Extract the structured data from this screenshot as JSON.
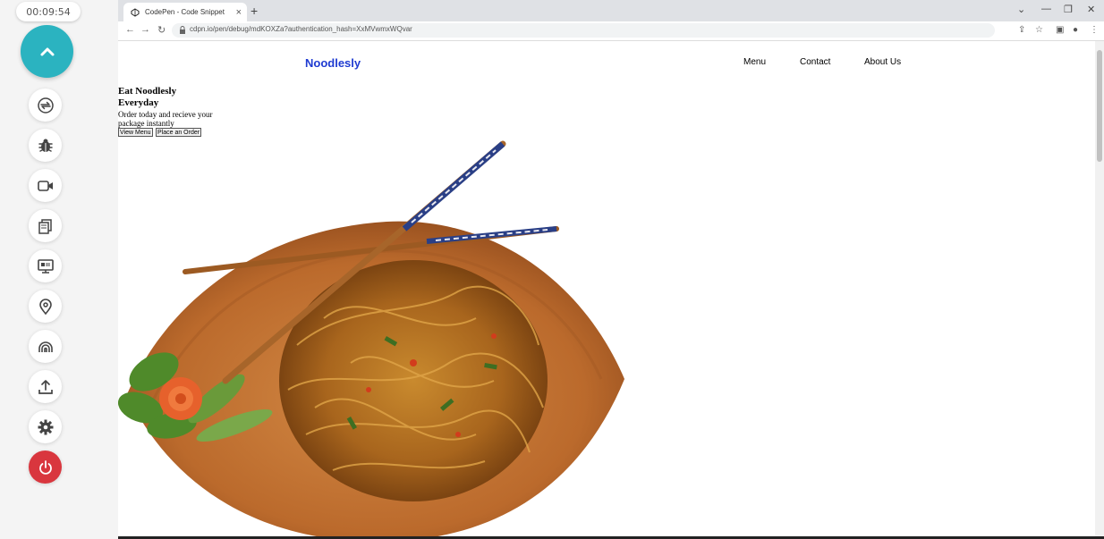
{
  "recorder": {
    "timer": "00:09:54",
    "tools": [
      {
        "icon": "sync-icon"
      },
      {
        "icon": "bug-icon"
      },
      {
        "icon": "video-icon"
      },
      {
        "icon": "copy-icon"
      },
      {
        "icon": "screen-icon"
      },
      {
        "icon": "location-pin-icon"
      },
      {
        "icon": "signal-icon"
      },
      {
        "icon": "upload-icon"
      },
      {
        "icon": "gear-icon"
      },
      {
        "icon": "power-icon"
      }
    ],
    "accent": "#2bb3c0",
    "power_color": "#d9363e"
  },
  "browser": {
    "tab_title": "CodePen - Code Snippet",
    "url": "cdpn.io/pen/debug/mdKOXZa?authentication_hash=XxMVwmxWQvar"
  },
  "page": {
    "brand": "Noodlesly",
    "brand_color": "#1f3bd1",
    "nav": [
      "Menu",
      "Contact",
      "About Us"
    ],
    "hero": {
      "title_line1": "Eat Noodlesly",
      "title_line2": "Everyday",
      "subtitle": "Order today and recieve your package instantly",
      "buttons": [
        "View Menu",
        "Place an Order"
      ]
    }
  }
}
